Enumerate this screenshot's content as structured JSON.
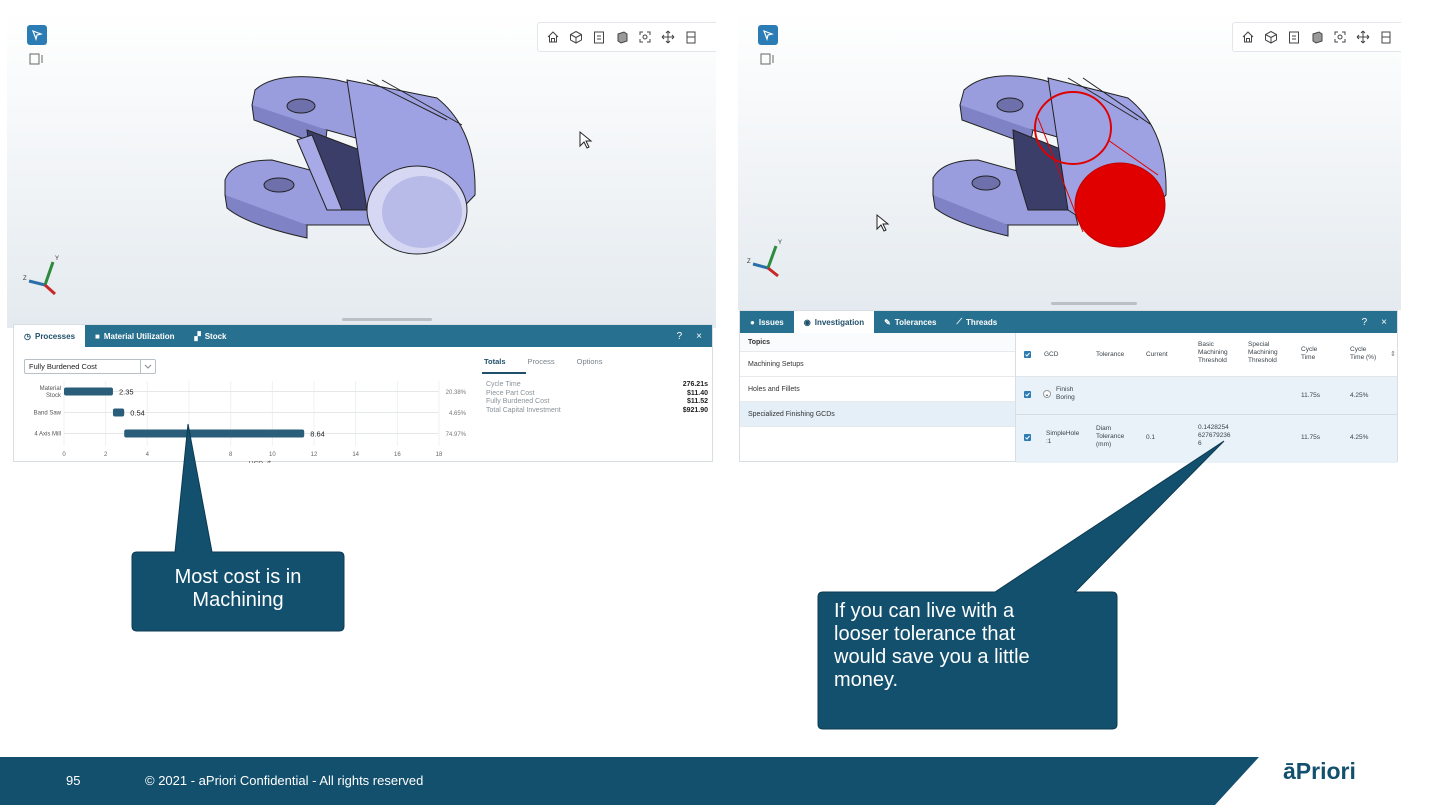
{
  "left_screen": {
    "panel": {
      "tabs": [
        "Processes",
        "Material Utilization",
        "Stock"
      ],
      "active_tab": "Processes",
      "help": "?",
      "close": "×",
      "cost_select": {
        "value": "Fully Burdened Cost"
      },
      "subtabs": [
        "Totals",
        "Process",
        "Options"
      ],
      "active_subtab": "Totals",
      "totals": [
        {
          "label": "Cycle Time",
          "value": "276.21s"
        },
        {
          "label": "Piece Part Cost",
          "value": "$11.40"
        },
        {
          "label": "Fully Burdened Cost",
          "value": "$11.52"
        },
        {
          "label": "Total Capital Investment",
          "value": "$921.90"
        }
      ]
    }
  },
  "chart_data": {
    "type": "bar",
    "orientation": "horizontal",
    "categories": [
      "Material Stock",
      "Band Saw",
      "4 Axis Mill"
    ],
    "category_lines": [
      [
        "Material",
        "Stock"
      ],
      [
        "Band Saw"
      ],
      [
        "4 Axis Mill"
      ]
    ],
    "values": [
      2.35,
      0.54,
      8.64
    ],
    "value_labels": [
      "2.35",
      "0.54",
      "8.64"
    ],
    "starts": [
      0,
      2.35,
      2.89
    ],
    "percent_labels": [
      "20.38%",
      "4.65%",
      "74.97%"
    ],
    "x_ticks": [
      "0",
      "2",
      "4",
      "6",
      "8",
      "10",
      "12",
      "14",
      "16",
      "18"
    ],
    "x_domain": [
      0,
      18
    ],
    "xlabel": "USD, $",
    "bar_color": "#2a5d7a",
    "grid": true
  },
  "right_screen": {
    "panel": {
      "tabs": [
        "Issues",
        "Investigation",
        "Tolerances",
        "Threads"
      ],
      "active_tab": "Investigation",
      "help": "?",
      "close": "×",
      "topics_header": "Topics",
      "topics": [
        "Machining Setups",
        "Holes and Fillets",
        "Specialized Finishing GCDs"
      ],
      "selected_topic": "Specialized Finishing GCDs",
      "table": {
        "columns": {
          "gcd": "GCD",
          "tolerance": "Tolerance",
          "current": "Current",
          "basic": [
            "Basic",
            "Machining",
            "Threshold"
          ],
          "special": [
            "Special",
            "Machining",
            "Threshold"
          ],
          "cycle": [
            "Cycle",
            "Time"
          ],
          "cycle_pct": [
            "Cycle",
            "Time (%)"
          ]
        },
        "rows": [
          {
            "gcd": [
              "Finish",
              "Boring"
            ],
            "tolerance": [],
            "current": "",
            "basic": [],
            "cycle": "11.75s",
            "cycle_pct": "4.25%"
          },
          {
            "gcd": [
              "SimpleHole",
              ":1"
            ],
            "tolerance": [
              "Diam",
              "Tolerance",
              "(mm)"
            ],
            "current": "0.1",
            "basic": [
              "0.1428254",
              "627679236",
              "6"
            ],
            "cycle": "11.75s",
            "cycle_pct": "4.25%"
          }
        ]
      }
    }
  },
  "callouts": {
    "left": [
      "Most cost is in",
      "Machining"
    ],
    "right": [
      "If you can live with a",
      "looser tolerance that",
      "would save you a little",
      "money."
    ]
  },
  "footer": {
    "slide_number": "95",
    "copyright": "© 2021 - aPriori Confidential - All rights reserved",
    "logo": "āPriori"
  },
  "colors": {
    "tab_bar": "#27708f",
    "callout": "#13506e",
    "footer": "#13506e",
    "part": "#9c9fe0",
    "highlight": "#e00000"
  }
}
